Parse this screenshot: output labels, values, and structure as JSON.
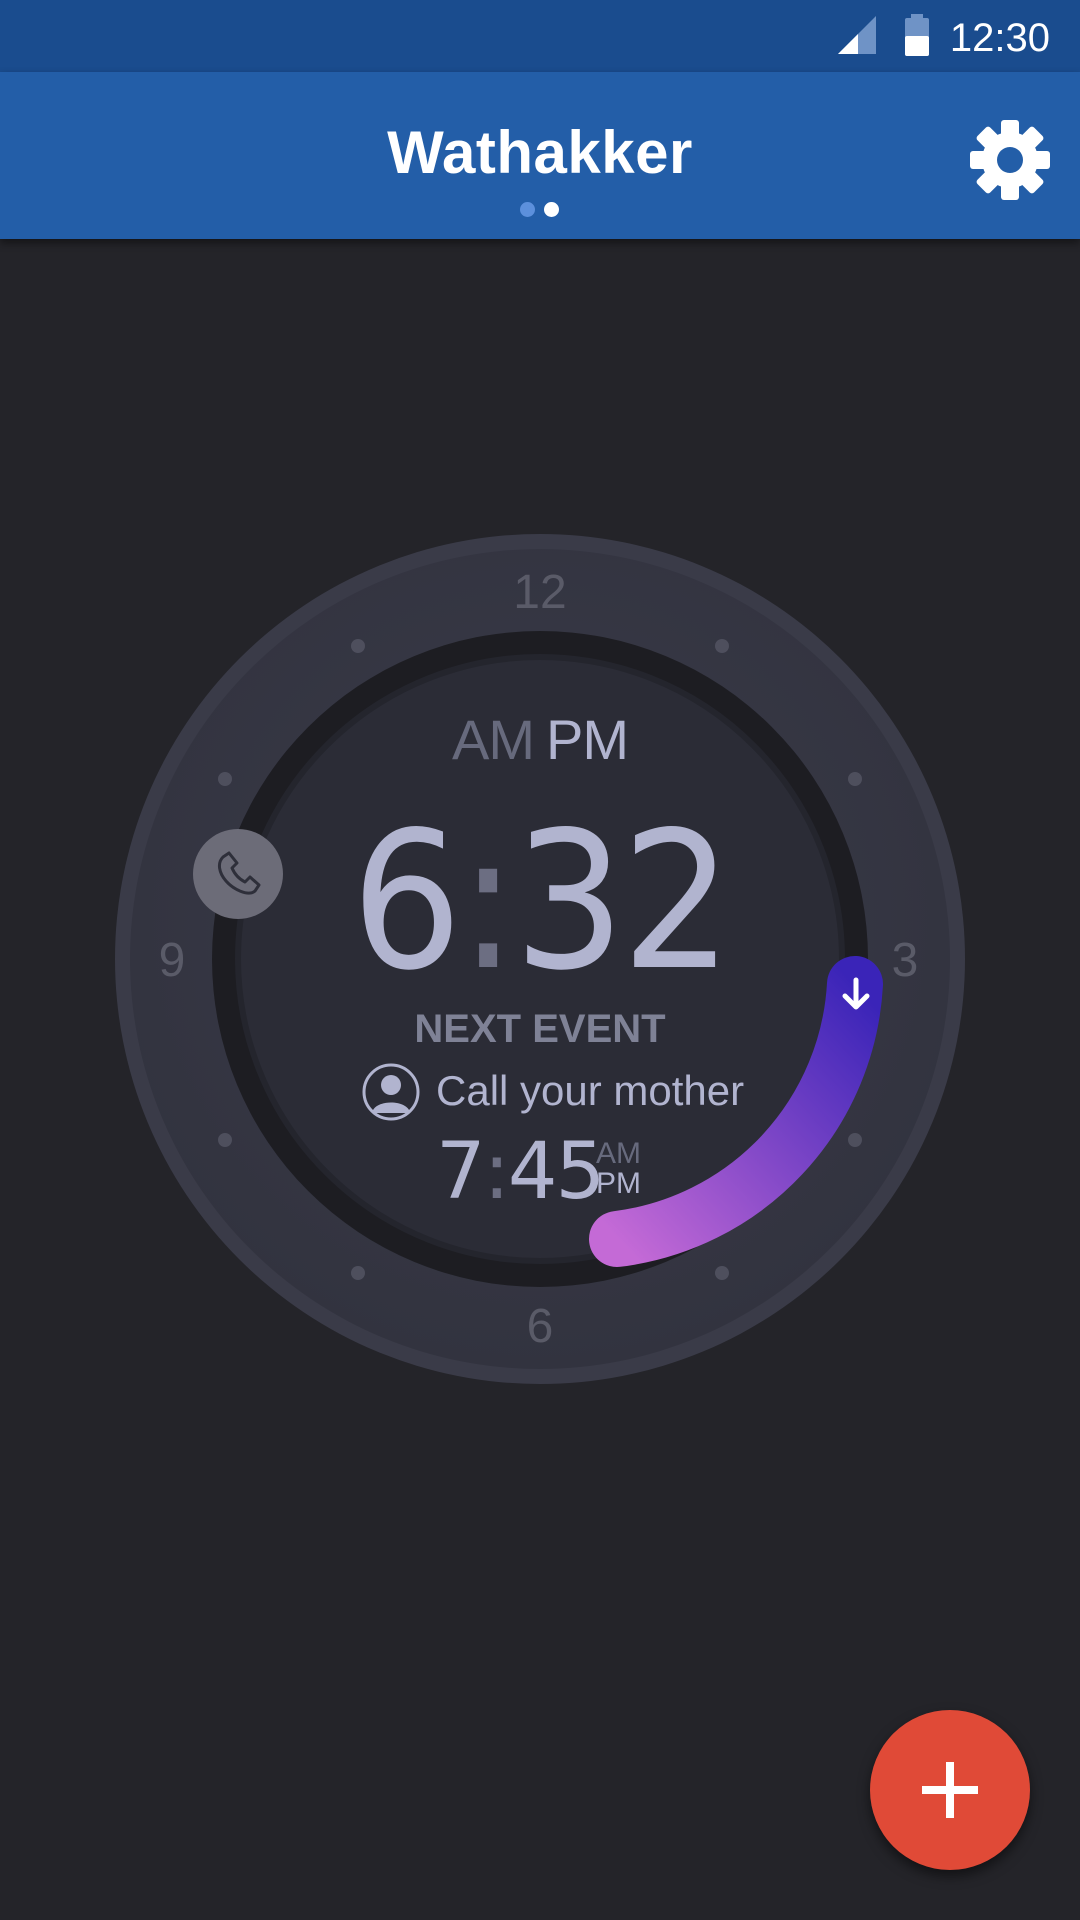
{
  "status_bar": {
    "time": "12:30"
  },
  "app_bar": {
    "title": "Wathakker",
    "page_count": 2,
    "active_page": 2
  },
  "clock": {
    "numbers": {
      "top": "12",
      "right": "3",
      "bottom": "6",
      "left": "9"
    },
    "ampm": {
      "am": "AM",
      "pm": "PM",
      "selected": "PM"
    },
    "time": {
      "hours": "6",
      "colon": ":",
      "minutes": "32"
    }
  },
  "next_event": {
    "label": "NEXT EVENT",
    "title": "Call your mother",
    "time": {
      "hours": "7",
      "colon": ":",
      "minutes": "45"
    },
    "ampm": {
      "am": "AM",
      "pm": "PM",
      "selected": "PM"
    },
    "icon": "person-avatar-icon"
  },
  "icons": {
    "settings": "gear-icon",
    "phone": "phone-icon",
    "arc_handle": "arrow-down-icon",
    "fab": "plus-icon"
  },
  "colors": {
    "status_bar": "#1a4c8e",
    "app_bar": "#235ea8",
    "background": "#242429",
    "arc_start": "#3a24b8",
    "arc_end": "#c46ad6",
    "fab": "#e04a37"
  }
}
